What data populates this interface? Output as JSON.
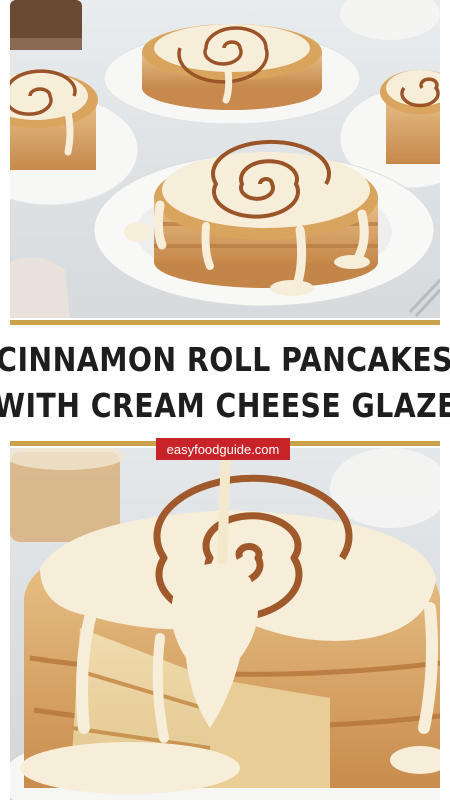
{
  "title": {
    "line1": "CINNAMON ROLL PANCAKES",
    "line2": "WITH CREAM CHEESE GLAZE"
  },
  "badge": {
    "text": "easyfoodguide.com"
  },
  "colors": {
    "accent_gold": "#c9a24a",
    "badge_red": "#c9232a",
    "glaze_cream": "#f6eed9",
    "cinnamon_swirl": "#9a5428",
    "pancake_gold": "#d9a45e"
  },
  "photos": {
    "top": "cinnamon-roll-pancake-stacks-on-plates",
    "bottom": "glaze-pouring-onto-pancake-stack-closeup"
  }
}
